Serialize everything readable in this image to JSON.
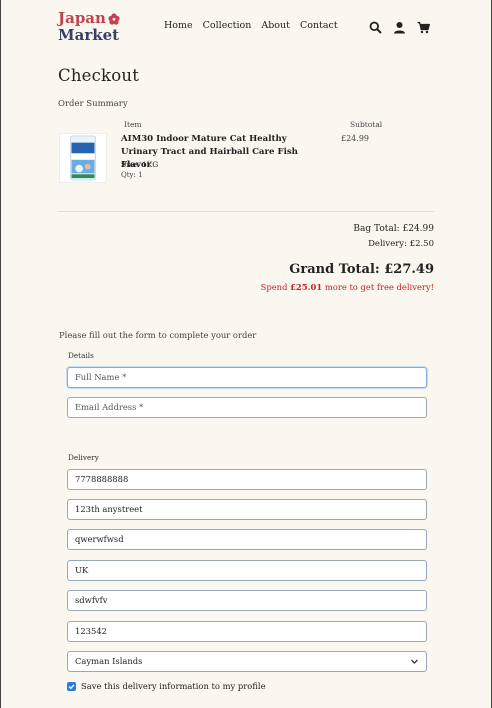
{
  "brand": {
    "line1": "Japan",
    "line2": "Market"
  },
  "nav": [
    "Home",
    "Collection",
    "About",
    "Contact"
  ],
  "header_icons": [
    "search-icon",
    "user-icon",
    "cart-icon"
  ],
  "page_title": "Checkout",
  "order_summary_label": "Order Summary",
  "columns": {
    "item": "Item",
    "subtotal": "Subtotal"
  },
  "product": {
    "name": "AIM30 Indoor Mature Cat Healthy Urinary Tract and Hairball Care Fish Flavor",
    "size": "Size: 1KG",
    "qty": "Qty: 1",
    "price": "£24.99"
  },
  "totals": {
    "bag_total": "Bag Total: £24.99",
    "delivery": "Delivery: £2.50",
    "grand_total": "Grand Total: £27.49",
    "free_prefix": "Spend ",
    "free_amount": "£25.01",
    "free_suffix": " more to get free delivery!"
  },
  "form": {
    "intro": "Please fill out the form to complete your order",
    "details_label": "Details",
    "full_name_placeholder": "Full Name *",
    "email_placeholder": "Email Address *",
    "delivery_label": "Delivery",
    "phone": "7778888888",
    "address1": "123th anystreet",
    "address2": "qwerwfwsd",
    "country_text": "UK",
    "city": "sdwfvfv",
    "postcode": "123542",
    "country_select": "Cayman Islands",
    "save_label": "Save this delivery information to my profile",
    "save_checked": true
  },
  "colors": {
    "background": "#faf6f0",
    "brand_red": "#c2424f",
    "brand_navy": "#3a3f66",
    "alert_red": "#c82222",
    "checkbox_blue": "#2b7de0"
  }
}
